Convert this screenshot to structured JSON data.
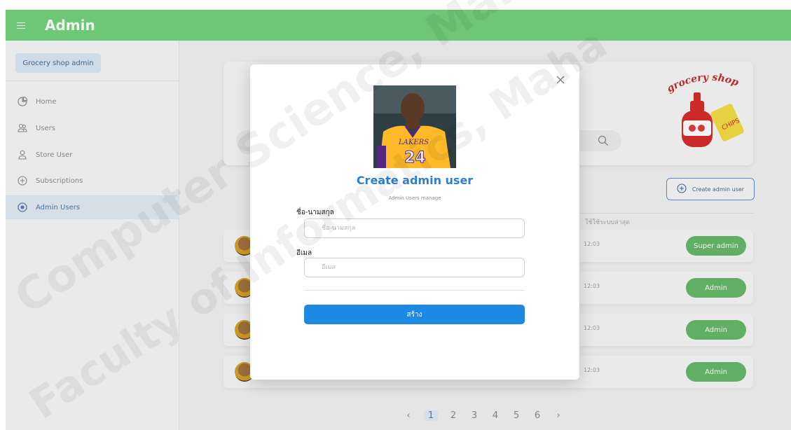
{
  "header": {
    "title": "Admin",
    "menu_icon": "hamburger-icon",
    "bg_color": "#74d27b"
  },
  "sidebar": {
    "shop_label": "Grocery shop admin",
    "items": [
      {
        "label": "Home",
        "icon": "dashboard-icon"
      },
      {
        "label": "Users",
        "icon": "users-icon"
      },
      {
        "label": "Store User",
        "icon": "user-icon"
      },
      {
        "label": "Subscriptions",
        "icon": "plus-circle-icon"
      },
      {
        "label": "Admin Users",
        "icon": "eye-icon",
        "active": true
      }
    ]
  },
  "main": {
    "create_button_label": "Create admin user",
    "column_header": "ใช้ใช้ระบบล่าสุด",
    "rows": [
      {
        "time": "12:03",
        "role": "Super admin"
      },
      {
        "time": "12:03",
        "role": "Admin"
      },
      {
        "time": "12:03",
        "role": "Admin"
      },
      {
        "time": "12:03",
        "role": "Admin"
      }
    ],
    "pagination": {
      "prev": "‹",
      "pages": [
        "1",
        "2",
        "3",
        "4",
        "5",
        "6"
      ],
      "current": "1",
      "next": "›"
    }
  },
  "modal": {
    "title": "Create admin user",
    "subtitle": "Admin Users manage",
    "name_label": "ชื่อ-นามสกุล",
    "name_placeholder": "ชื่อ-นามสกุล",
    "email_label": "อีเมล",
    "email_placeholder": "อีเมล",
    "submit_label": "สร้าง",
    "photo_number": "24",
    "photo_team": "LAKERS"
  },
  "logo": {
    "text": "grocery shop",
    "badge": "CHIPS"
  },
  "watermark": {
    "line1": "Computer Science, Maha",
    "line2": "Faculty of Informatics, Maha"
  },
  "colors": {
    "accent": "#1e88e5",
    "primary_title": "#2d7fd0",
    "role_badge": "#66b96b"
  }
}
